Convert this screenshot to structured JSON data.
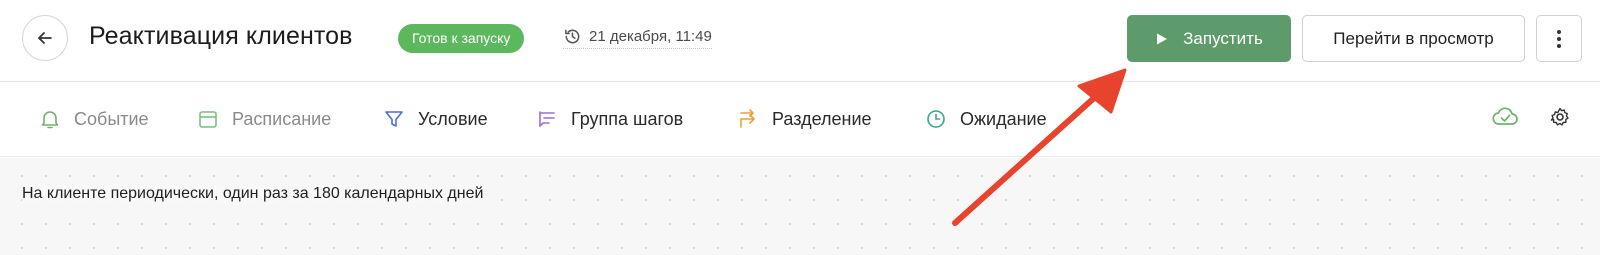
{
  "header": {
    "title": "Реактивация клиентов",
    "status": "Готов к запуску",
    "timestamp": "21 декабря, 11:49",
    "run_label": "Запустить",
    "preview_label": "Перейти в просмотр"
  },
  "toolbar": {
    "items": [
      {
        "label": "Событие",
        "icon": "bell-icon"
      },
      {
        "label": "Расписание",
        "icon": "calendar-icon"
      },
      {
        "label": "Условие",
        "icon": "filter-icon"
      },
      {
        "label": "Группа шагов",
        "icon": "step-group-icon"
      },
      {
        "label": "Разделение",
        "icon": "split-icon"
      },
      {
        "label": "Ожидание",
        "icon": "clock-icon"
      }
    ]
  },
  "canvas": {
    "condition_text": "На клиенте периодически, один раз за 180 календарных дней"
  },
  "colors": {
    "status_badge": "#5cb85c",
    "run_button": "#5e9b6a",
    "annotation_arrow": "#e8432d"
  }
}
